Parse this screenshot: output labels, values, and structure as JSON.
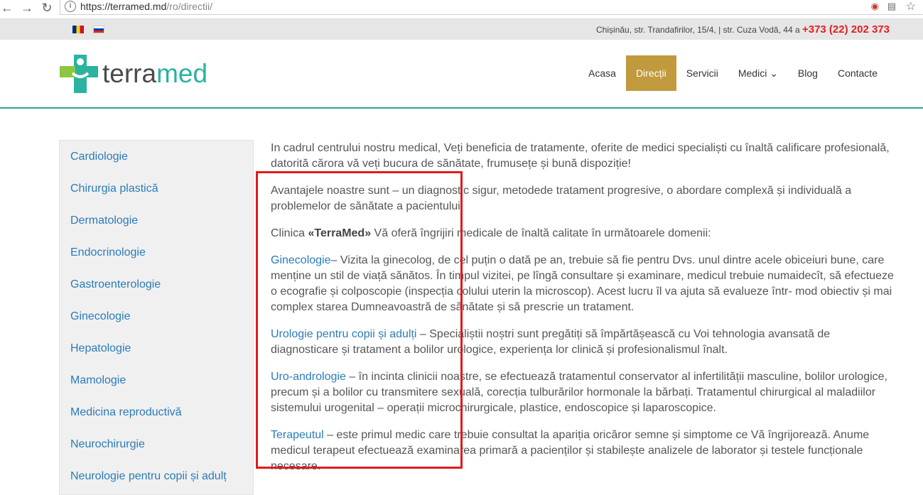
{
  "browser": {
    "url_host": "https://terramed.md",
    "url_path": "/ro/directii/",
    "info_glyph": "i",
    "back_glyph": "←",
    "forward_glyph": "→",
    "reload_glyph": "↻",
    "star_glyph": "☆"
  },
  "topbar": {
    "address": "Chișinău, str. Trandafirilor, 15/4, | str. Cuza Vodă, 44 a",
    "phone": "+373 (22) 202 373"
  },
  "logo": {
    "word_a": "terra",
    "word_b": "med"
  },
  "nav": [
    {
      "label": "Acasa"
    },
    {
      "label": "Direcții"
    },
    {
      "label": "Servicii"
    },
    {
      "label": "Medici ⌄"
    },
    {
      "label": "Blog"
    },
    {
      "label": "Contacte"
    }
  ],
  "sidebar": [
    "Cardiologie",
    "Chirurgia plastică",
    "Dermatologie",
    "Endocrinologie",
    "Gastroenterologie",
    "Ginecologie",
    "Hepatologie",
    "Mamologie",
    "Medicina reproductivă",
    "Neurochirurgie",
    "Neurologie pentru copii și adulț"
  ],
  "content": {
    "intro": "In cadrul centrului nostru medical, Veți beneficia de tratamente, oferite de medici specialiști cu înaltă calificare profesională, datorită cărora vă veți bucura de sănătate, frumusețe și bună dispoziție!",
    "advantages": "Avantajele noastre sunt  – un diagnostic sigur, metodede tratament progresive,  o abordare complexă și individuală a problemelor de sănătate a pacientului.",
    "clinic_pre": "Clinica ",
    "clinic_name": "«TerraMed»",
    "clinic_post": " Vă oferă îngrijiri medicale de înaltă calitate în următoarele domenii:",
    "ginecologie_link": "Ginecologie",
    "ginecologie_text": "– Vizita la ginecolog, de cel puțin o dată pe an, trebuie să fie pentru Dvs. unul dintre acele obiceiuri bune, care menține  un stil de viață sănătos. În timpul vizitei, pe lîngă consultare și examinare, medicul trebuie numaidecît,  să efectueze o ecografie și colposcopie (inspecția colului uterin la microscop). Acest lucru îl va ajuta să evalueze într- mod obiectiv și mai complex starea Dumneavoastră de sănătate și să prescrie un tratament.",
    "urologie_link": "Urologie pentru copii și adulți",
    "urologie_text": " – Specialiștii noștri sunt pregătiți să împărtășească cu Voi tehnologia avansată de diagnosticare și tratament a bolilor urologice, experiența lor clinică și profesionalismul înalt.",
    "uro_link": "Uro-andrologie",
    "uro_text": " –   în incinta clinicii noastre, se efectuează tratamentul conservator al infertilității masculine, bolilor urologice, precum și a bolilor cu transmitere sexuală, corecția tulburărilor hormonale la bărbați. Tratamentul chirurgical al maladiilor sistemului urogenital – operații microchirurgicale, plastice, endoscopice și laparoscopice.",
    "terapeut_link": "Terapeutul",
    "terapeut_text": " – este primul medic care trebuie consultat la apariția oricăror semne și simptome ce Vă îngrijorează. Anume medicul terapeut efectuează examinarea primară a pacienților și stabilește analizele de laborator și testele funcționale necesare."
  },
  "colors": {
    "accent": "#c19a3d",
    "link": "#2b7bb9",
    "brand": "#29b3a0",
    "phone": "#e02020",
    "highlight_box": "#e21b1b"
  }
}
